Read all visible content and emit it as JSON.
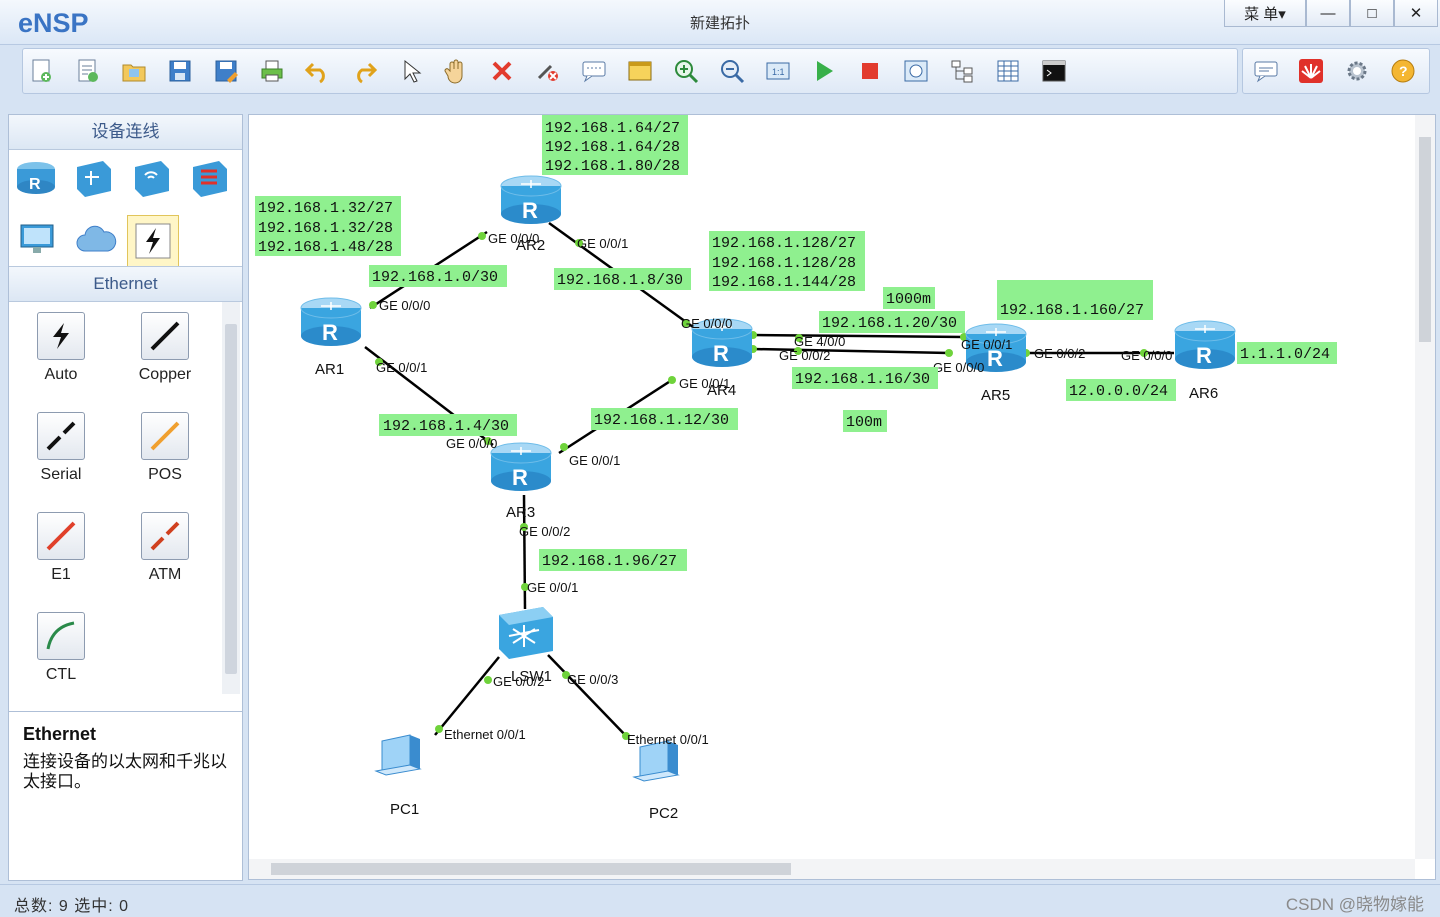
{
  "app": {
    "logo": "eNSP",
    "window_title": "新建拓扑",
    "menu_label": "菜 单▾",
    "minimize": "—",
    "maximize": "□",
    "close": "✕"
  },
  "left_panel": {
    "title": "设备连线",
    "category": "Ethernet",
    "cables": [
      {
        "label": "Auto",
        "color": "#111111"
      },
      {
        "label": "Copper",
        "color": "#111111"
      },
      {
        "label": "Serial",
        "color": "#111111"
      },
      {
        "label": "POS",
        "color": "#f0a030"
      },
      {
        "label": "E1",
        "color": "#e0402a"
      },
      {
        "label": "ATM",
        "color": "#d0401f"
      },
      {
        "label": "CTL",
        "color": "#2a8a4a"
      }
    ],
    "desc_title": "Ethernet",
    "desc_text": "连接设备的以太网和千兆以太接口。"
  },
  "topology": {
    "devices": {
      "AR1": "AR1",
      "AR2": "AR2",
      "AR3": "AR3",
      "AR4": "AR4",
      "AR5": "AR5",
      "AR6": "AR6",
      "LSW1": "LSW1",
      "PC1": "PC1",
      "PC2": "PC2"
    },
    "ports": {
      "ar2_g000": "GE 0/0/0",
      "ar2_g001": "GE 0/0/1",
      "ar1_g000": "GE 0/0/0",
      "ar1_g001": "GE 0/0/1",
      "ar4_g000": "GE 0/0/0",
      "ar4_g001": "GE 0/0/1",
      "ar4_g400": "GE 4/0/0",
      "ar4_g002": "GE 0/0/2",
      "ar5_g001": "GE 0/0/1",
      "ar5_g000": "GE 0/0/0",
      "ar5_g002": "GE 0/0/2",
      "ar6_g000": "GE 0/0/0",
      "ar3_g000": "GE 0/0/0",
      "ar3_g001": "GE 0/0/1",
      "ar3_g002": "GE 0/0/2",
      "lsw_g001": "GE 0/0/1",
      "lsw_g002": "GE 0/0/2",
      "lsw_g003": "GE 0/0/3",
      "pc1_eth": "Ethernet 0/0/1",
      "pc2_eth": "Ethernet 0/0/1"
    },
    "notes": {
      "ar2_lan": [
        "192.168.1.64/27",
        "192.168.1.64/28",
        "192.168.1.80/28"
      ],
      "ar1_lan": [
        "192.168.1.32/27",
        "192.168.1.32/28",
        "192.168.1.48/28"
      ],
      "ar4_lan": [
        "192.168.1.128/27",
        "192.168.1.128/28",
        "192.168.1.144/28"
      ],
      "ar1_ar2": "192.168.1.0/30",
      "ar2_ar4": "192.168.1.8/30",
      "bw_1000": "1000m",
      "ar4_ar5_a": "192.168.1.20/30",
      "ar5_lan": "192.168.1.160/27",
      "ar4_ar5_b": "192.168.1.16/30",
      "bw_100": "100m",
      "ar6_loop": "1.1.1.0/24",
      "ar5_ar6": "12.0.0.0/24",
      "ar1_ar3": "192.168.1.4/30",
      "ar3_ar4": "192.168.1.12/30",
      "ar3_lsw": "192.168.1.96/27"
    }
  },
  "status": {
    "text": "总数: 9  选中: 0",
    "watermark": "CSDN @晓物嫁能"
  },
  "colors": {
    "note_bg": "#8ff08f",
    "link": "#000000",
    "port_dot": "#6fd33b",
    "router_blue": "#3aa5e0"
  }
}
